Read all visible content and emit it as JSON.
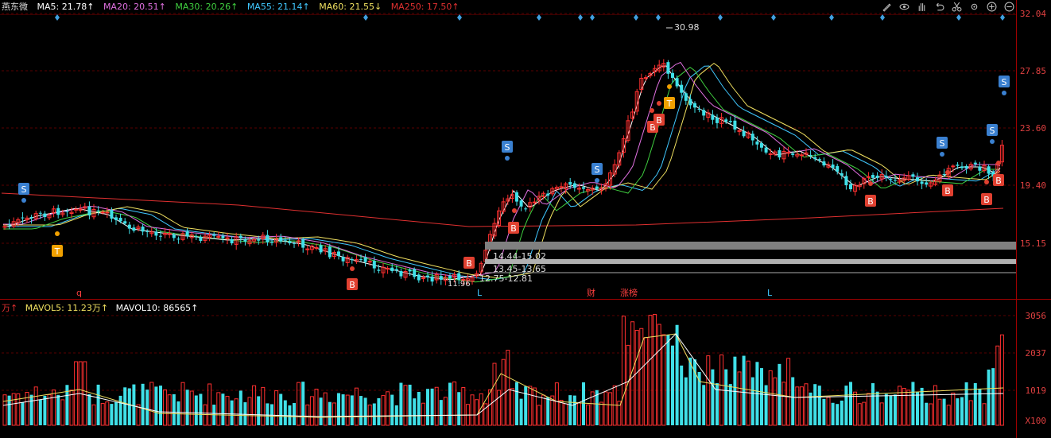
{
  "stock_name": "燕东微",
  "indicators": [
    {
      "label": "MA5: 21.78↑",
      "color": "#ffffff"
    },
    {
      "label": "MA20: 20.51↑",
      "color": "#e070e0"
    },
    {
      "label": "MA30: 20.26↑",
      "color": "#40d040"
    },
    {
      "label": "MA55: 21.14↑",
      "color": "#40c8ff"
    },
    {
      "label": "MA60: 21.55↓",
      "color": "#f0e060"
    },
    {
      "label": "MA250: 17.50↑",
      "color": "#e03030"
    }
  ],
  "vol_indicators": [
    {
      "label": "万↑",
      "color": "#e03030"
    },
    {
      "label": "MAVOL5: 11.23万↑",
      "color": "#f0e060"
    },
    {
      "label": "MAVOL10: 86565↑",
      "color": "#ffffff"
    }
  ],
  "price_axis": [
    "32.04",
    "27.85",
    "23.60",
    "19.40",
    "15.15"
  ],
  "volume_axis": [
    "3056",
    "2037",
    "1019",
    "X100"
  ],
  "annotations": {
    "high": "30.98",
    "low": "11.96",
    "zone1": "14.44-15.02",
    "zone2": "13.45-13.65",
    "zone3": "12.75-12.81",
    "q_mark": "q",
    "l_mark1": "L",
    "l_mark2": "L",
    "cai": "财",
    "zhangbang": "涨榜"
  },
  "signal_labels": {
    "buy": "B",
    "sell": "S",
    "t": "T"
  },
  "toolbar_icons": [
    "pen-icon",
    "eye-icon",
    "hand-icon",
    "undo-icon",
    "scissors-icon",
    "gear-icon",
    "zoom-in-icon",
    "zoom-out-icon"
  ]
}
